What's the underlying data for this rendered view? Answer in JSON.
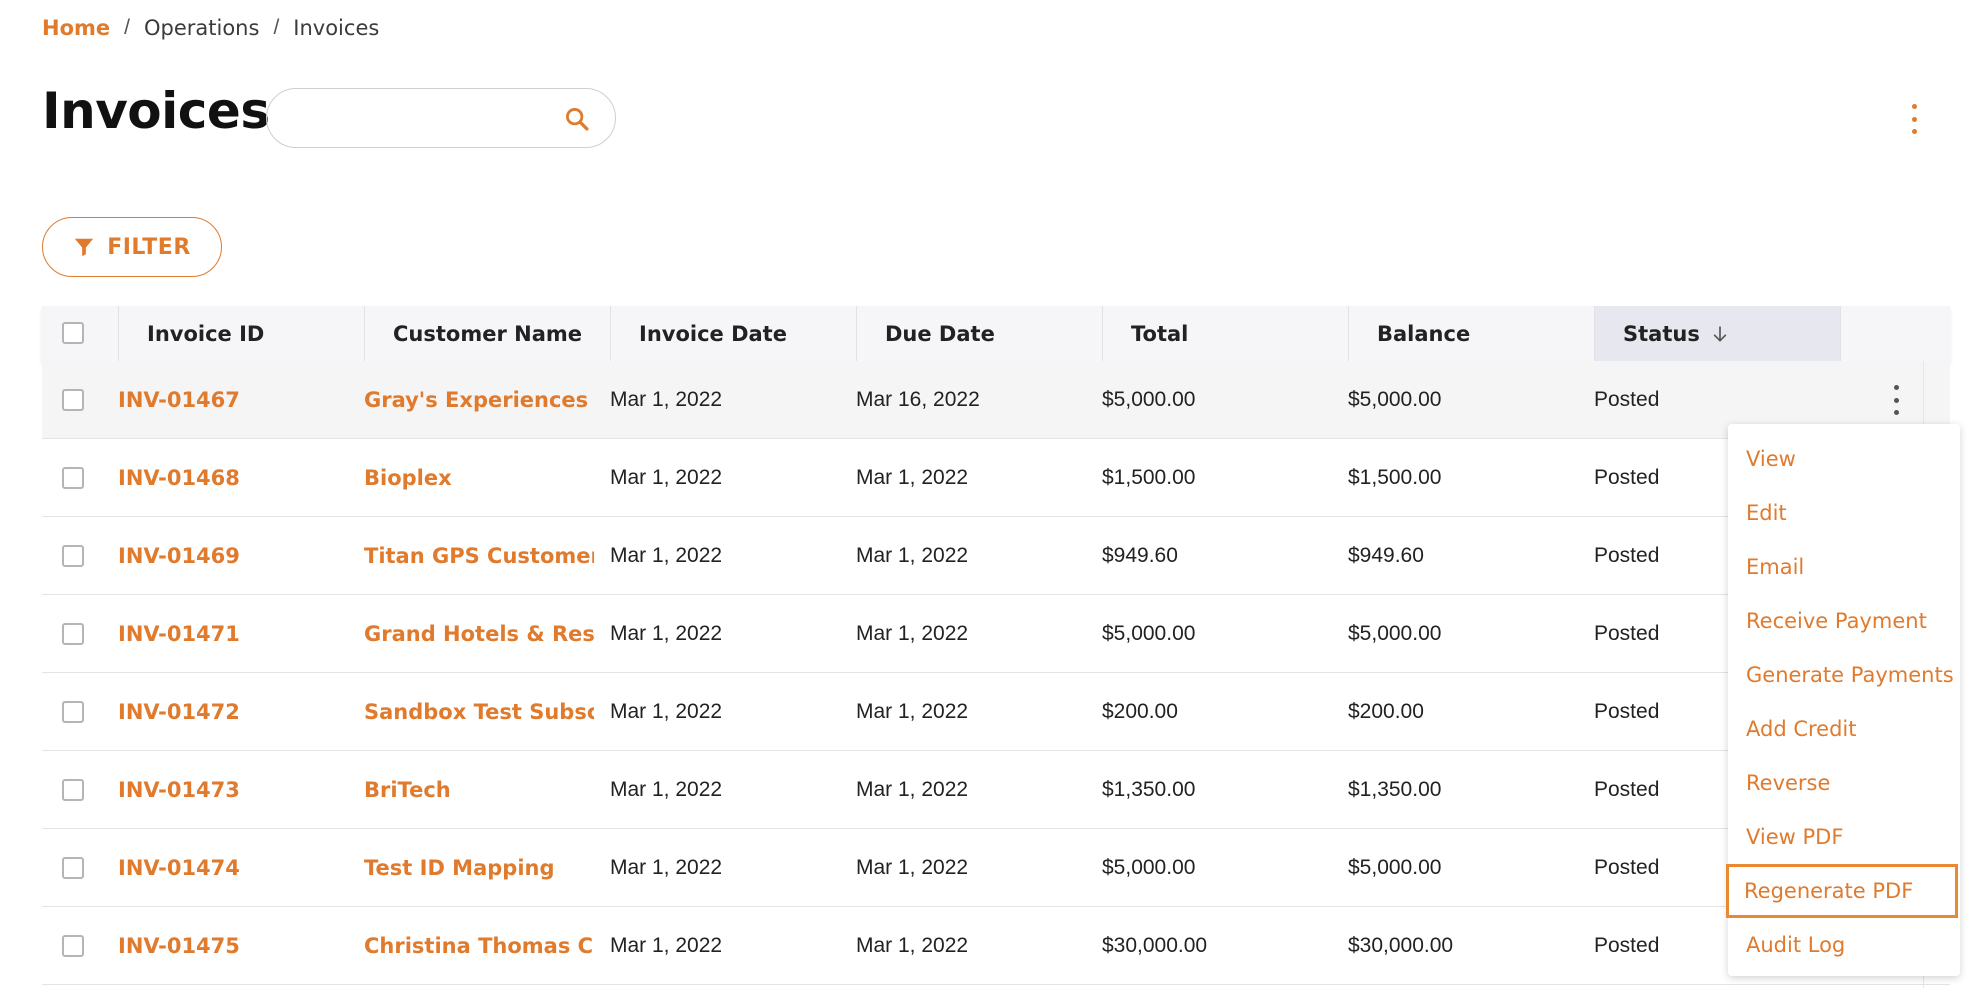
{
  "breadcrumb": {
    "home": "Home",
    "items": [
      "Operations",
      "Invoices"
    ],
    "separator": "/"
  },
  "page": {
    "title": "Invoices"
  },
  "search": {
    "value": "",
    "placeholder": ""
  },
  "filter": {
    "label": "FILTER"
  },
  "table": {
    "columns": [
      "Invoice ID",
      "Customer Name",
      "Invoice Date",
      "Due Date",
      "Total",
      "Balance",
      "Status"
    ],
    "sort": {
      "column": "Status",
      "direction": "descending"
    },
    "rows": [
      {
        "id": "INV-01467",
        "customer": "Gray's Experiences",
        "invoice_date": "Mar 1, 2022",
        "due_date": "Mar 16, 2022",
        "total": "$5,000.00",
        "balance": "$5,000.00",
        "status": "Posted"
      },
      {
        "id": "INV-01468",
        "customer": "Bioplex",
        "invoice_date": "Mar 1, 2022",
        "due_date": "Mar 1, 2022",
        "total": "$1,500.00",
        "balance": "$1,500.00",
        "status": "Posted"
      },
      {
        "id": "INV-01469",
        "customer": "Titan GPS Customer",
        "invoice_date": "Mar 1, 2022",
        "due_date": "Mar 1, 2022",
        "total": "$949.60",
        "balance": "$949.60",
        "status": "Posted"
      },
      {
        "id": "INV-01471",
        "customer": "Grand Hotels & Reso",
        "invoice_date": "Mar 1, 2022",
        "due_date": "Mar 1, 2022",
        "total": "$5,000.00",
        "balance": "$5,000.00",
        "status": "Posted"
      },
      {
        "id": "INV-01472",
        "customer": "Sandbox Test Subscr",
        "invoice_date": "Mar 1, 2022",
        "due_date": "Mar 1, 2022",
        "total": "$200.00",
        "balance": "$200.00",
        "status": "Posted"
      },
      {
        "id": "INV-01473",
        "customer": "BriTech",
        "invoice_date": "Mar 1, 2022",
        "due_date": "Mar 1, 2022",
        "total": "$1,350.00",
        "balance": "$1,350.00",
        "status": "Posted"
      },
      {
        "id": "INV-01474",
        "customer": "Test ID Mapping",
        "invoice_date": "Mar 1, 2022",
        "due_date": "Mar 1, 2022",
        "total": "$5,000.00",
        "balance": "$5,000.00",
        "status": "Posted"
      },
      {
        "id": "INV-01475",
        "customer": "Christina Thomas Cl",
        "invoice_date": "Mar 1, 2022",
        "due_date": "Mar 1, 2022",
        "total": "$30,000.00",
        "balance": "$30,000.00",
        "status": "Posted"
      }
    ]
  },
  "context_menu": {
    "items": [
      "View",
      "Edit",
      "Email",
      "Receive Payment",
      "Generate Payments",
      "Add Credit",
      "Reverse",
      "View PDF",
      "Regenerate PDF",
      "Audit Log"
    ],
    "highlighted": "Regenerate PDF"
  },
  "icons": {
    "search": "search-icon",
    "filter": "filter-icon",
    "sort": "arrow-down-icon",
    "more": "kebab-menu-icon"
  },
  "colors": {
    "accent": "#e07a2c",
    "header_bg": "#f6f6f8",
    "sorted_header_bg": "#e7e8ef",
    "row_hover": "#f5f5f5"
  }
}
